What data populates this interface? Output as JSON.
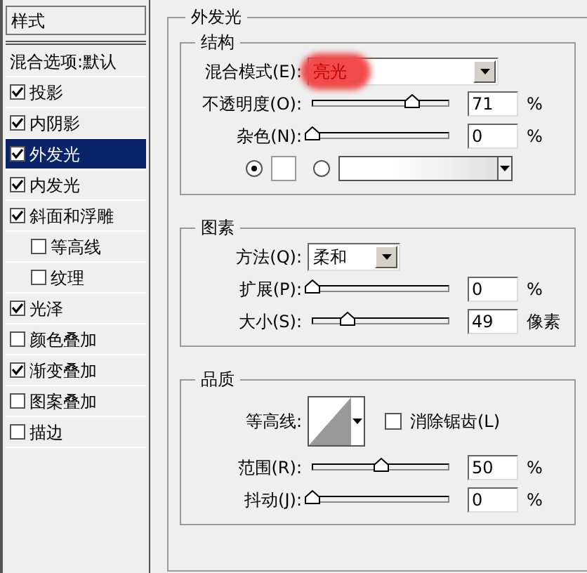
{
  "sidebar": {
    "header": "样式",
    "items": [
      {
        "kind": "plain",
        "label": "混合选项:默认",
        "selected": false
      },
      {
        "kind": "check",
        "label": "投影",
        "checked": true,
        "selected": false
      },
      {
        "kind": "check",
        "label": "内阴影",
        "checked": true,
        "selected": false
      },
      {
        "kind": "check",
        "label": "外发光",
        "checked": true,
        "selected": true
      },
      {
        "kind": "check",
        "label": "内发光",
        "checked": true,
        "selected": false
      },
      {
        "kind": "check",
        "label": "斜面和浮雕",
        "checked": true,
        "selected": false,
        "children": [
          {
            "kind": "check",
            "label": "等高线",
            "checked": false,
            "selected": false
          },
          {
            "kind": "check",
            "label": "纹理",
            "checked": false,
            "selected": false
          }
        ]
      },
      {
        "kind": "check",
        "label": "光泽",
        "checked": true,
        "selected": false
      },
      {
        "kind": "check",
        "label": "颜色叠加",
        "checked": false,
        "selected": false
      },
      {
        "kind": "check",
        "label": "渐变叠加",
        "checked": true,
        "selected": false
      },
      {
        "kind": "check",
        "label": "图案叠加",
        "checked": false,
        "selected": false
      },
      {
        "kind": "check",
        "label": "描边",
        "checked": false,
        "selected": false
      }
    ]
  },
  "panel": {
    "title": "外发光",
    "groups": [
      {
        "title": "结构",
        "rows": [
          {
            "kind": "dropdown",
            "label": "混合模式(E):",
            "value": "亮光",
            "highlighted": true
          },
          {
            "kind": "slider",
            "label": "不透明度(O):",
            "level": 0.72,
            "value": "71",
            "unit": "%"
          },
          {
            "kind": "slider",
            "label": "杂色(N):",
            "level": 0,
            "value": "0",
            "unit": "%"
          },
          {
            "kind": "color",
            "solid_selected": true,
            "gradient_selected": false
          }
        ]
      },
      {
        "title": "图素",
        "rows": [
          {
            "kind": "dropdown",
            "label": "方法(Q):",
            "value": "柔和",
            "highlighted": false
          },
          {
            "kind": "slider",
            "label": "扩展(P):",
            "level": 0,
            "value": "0",
            "unit": "%"
          },
          {
            "kind": "slider",
            "label": "大小(S):",
            "level": 0.25,
            "value": "49",
            "unit": "像素"
          }
        ]
      },
      {
        "title": "品质",
        "rows": [
          {
            "kind": "contour",
            "label": "等高线:",
            "checkbox_label": "消除锯齿(L)",
            "checked": false
          },
          {
            "kind": "slider",
            "label": "范围(R):",
            "level": 0.5,
            "value": "50",
            "unit": "%"
          },
          {
            "kind": "slider",
            "label": "抖动(J):",
            "level": 0,
            "value": "0",
            "unit": "%"
          }
        ]
      }
    ]
  }
}
